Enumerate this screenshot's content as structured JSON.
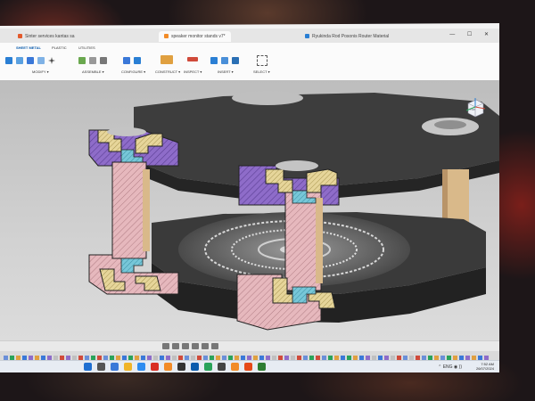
{
  "browser": {
    "tabs": [
      {
        "label": "Sinter services kantas sa",
        "icon_color": "#e35a2c"
      },
      {
        "label": "speaker monitor stands v7*",
        "icon_color": "#f28c28"
      },
      {
        "label": "Ryukinda Rod Posonis Router Material",
        "icon_color": "#2a7fd4"
      }
    ],
    "window_controls": "—  ☐  ✕"
  },
  "ribbon": {
    "tabs": [
      "SHEET METAL",
      "PLASTIC",
      "UTILITIES"
    ],
    "active_tab": "SHEET METAL",
    "groups": [
      {
        "label": "MODIFY ▾"
      },
      {
        "label": "ASSEMBLE ▾"
      },
      {
        "label": "CONFIGURE ▾"
      },
      {
        "label": "CONSTRUCT ▾"
      },
      {
        "label": "INSPECT ▾"
      },
      {
        "label": "INSERT ▾"
      },
      {
        "label": "SELECT ▾"
      }
    ]
  },
  "viewcube": {
    "face_label": "TOP"
  },
  "taskbar": {
    "weather": "",
    "time": "7:52 AM",
    "date": "26/07/2024",
    "tray_icons": "⌃  ENG  ◉  ))",
    "app_colors": [
      "#1f6fd1",
      "#555555",
      "#3a78d8",
      "#f0b429",
      "#2d8cf0",
      "#d93025",
      "#f28c28",
      "#333333",
      "#0b5cad",
      "#29a35a",
      "#444444",
      "#f28c28",
      "#e64a19",
      "#2e7d32"
    ]
  },
  "colors": {
    "section_purple": "#8e6cc9",
    "section_pink": "#e6b8bd",
    "section_yellow": "#e6d59a",
    "section_cyan": "#77c7d8",
    "dark_body": "#3a3a3a",
    "wood": "#d9b98a"
  }
}
